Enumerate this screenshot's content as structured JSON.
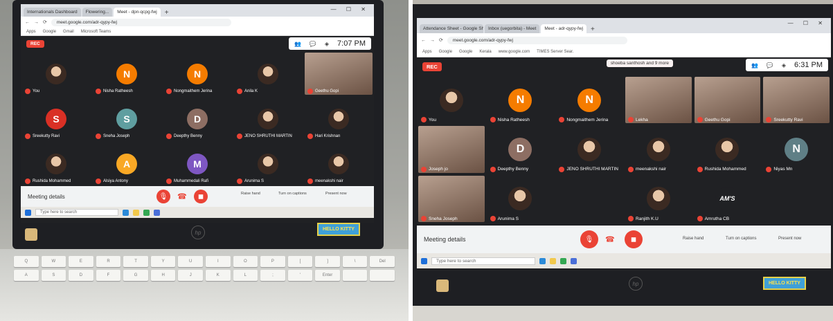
{
  "left": {
    "browser_tabs": [
      "Internationals Dashboard",
      "Flowering...",
      "Meet - dpn-qcpg-fwj"
    ],
    "url": "meet.google.com/adr-qypy-fwj",
    "bookmarks": [
      "Apps",
      "Google",
      "Gmail",
      "Microsoft Teams"
    ],
    "rec_label": "REC",
    "clock": "7:07 PM",
    "participants": [
      {
        "name": "You",
        "kind": "photo"
      },
      {
        "name": "Nisha Ratheesh",
        "kind": "letter",
        "initial": "N",
        "color": "#f57c00"
      },
      {
        "name": "Nongmaithem Jerina",
        "kind": "letter",
        "initial": "N",
        "color": "#f57c00"
      },
      {
        "name": "Anila K",
        "kind": "photo"
      },
      {
        "name": "Geethu Gopi",
        "kind": "camera"
      },
      {
        "name": "Sreekutty Ravi",
        "kind": "letter",
        "initial": "S",
        "color": "#d93025"
      },
      {
        "name": "Sneha Joseph",
        "kind": "letter",
        "initial": "S",
        "color": "#5f9ea0"
      },
      {
        "name": "Deepthy Benny",
        "kind": "letter",
        "initial": "D",
        "color": "#8d6e63"
      },
      {
        "name": "JENO SHRUTHI MARTIN",
        "kind": "photo"
      },
      {
        "name": "Hari Krishnan",
        "kind": "photo"
      },
      {
        "name": "Rushida Mohammed",
        "kind": "photo"
      },
      {
        "name": "Alsiya Antony",
        "kind": "letter",
        "initial": "A",
        "color": "#f9a825"
      },
      {
        "name": "Muhammedali Rafi",
        "kind": "letter",
        "initial": "M",
        "color": "#7e57c2"
      },
      {
        "name": "Arunima S",
        "kind": "photo"
      },
      {
        "name": "meenakshi nair",
        "kind": "photo"
      }
    ],
    "meeting_details": "Meeting details",
    "actions": [
      "Raise hand",
      "Turn on captions",
      "Present now"
    ],
    "search_placeholder": "Type here to search",
    "sticker_text": "HELLO KITTY",
    "brand": "hp",
    "keys": [
      "Q",
      "W",
      "E",
      "R",
      "T",
      "Y",
      "U",
      "I",
      "O",
      "P",
      "[",
      "]",
      "\\",
      "Del",
      "A",
      "S",
      "D",
      "F",
      "G",
      "H",
      "J",
      "K",
      "L",
      ";",
      "'",
      "Enter",
      "",
      ""
    ]
  },
  "right": {
    "browser_tabs": [
      "Attendance Sheet - Google Sheets",
      "Inbox (uegorbita) - Meet",
      "Meet - adr-qypy-fwj"
    ],
    "url": "meet.google.com/adr-qypy-fwj",
    "bookmarks": [
      "Apps",
      "Google",
      "Google",
      "Kerala",
      "www.google.com",
      "TIMES Server Sear."
    ],
    "rec_label": "REC",
    "notice": "shoeba santhosh and 9 more",
    "clock": "6:31 PM",
    "participants": [
      {
        "name": "You",
        "kind": "photo"
      },
      {
        "name": "Nisha Ratheesh",
        "kind": "letter",
        "initial": "N",
        "color": "#f57c00"
      },
      {
        "name": "Nongmaithem Jerina",
        "kind": "letter",
        "initial": "N",
        "color": "#f57c00"
      },
      {
        "name": "Lekha",
        "kind": "camera"
      },
      {
        "name": "Geethu Gopi",
        "kind": "camera"
      },
      {
        "name": "Sreekutty Ravi",
        "kind": "camera"
      },
      {
        "name": "Joseph jo",
        "kind": "camera"
      },
      {
        "name": "Deepthy Benny",
        "kind": "letter",
        "initial": "D",
        "color": "#8d6e63"
      },
      {
        "name": "JENO SHRUTHI MARTIN",
        "kind": "photo"
      },
      {
        "name": "meenakshi nair",
        "kind": "photo"
      },
      {
        "name": "Rushida Mohammed",
        "kind": "photo"
      },
      {
        "name": "Niyas Mn",
        "kind": "letter",
        "initial": "N",
        "color": "#5f7f86"
      },
      {
        "name": "Sneha Joseph",
        "kind": "camera"
      },
      {
        "name": "Arunima S",
        "kind": "photo"
      },
      {
        "name": "",
        "kind": "empty"
      },
      {
        "name": "Ranjith K.U",
        "kind": "photo"
      },
      {
        "name": "Amrutha CB",
        "kind": "letter",
        "initial": "AM'S",
        "color": "#202124"
      },
      {
        "name": "",
        "kind": "empty"
      }
    ],
    "meeting_details": "Meeting details",
    "actions": [
      "Raise hand",
      "Turn on captions",
      "Present now"
    ],
    "search_placeholder": "Type here to search",
    "sticker_text": "HELLO KITTY",
    "brand": "hp"
  },
  "colors": {
    "accent_red": "#ea4335",
    "meet_bg": "#202124"
  }
}
